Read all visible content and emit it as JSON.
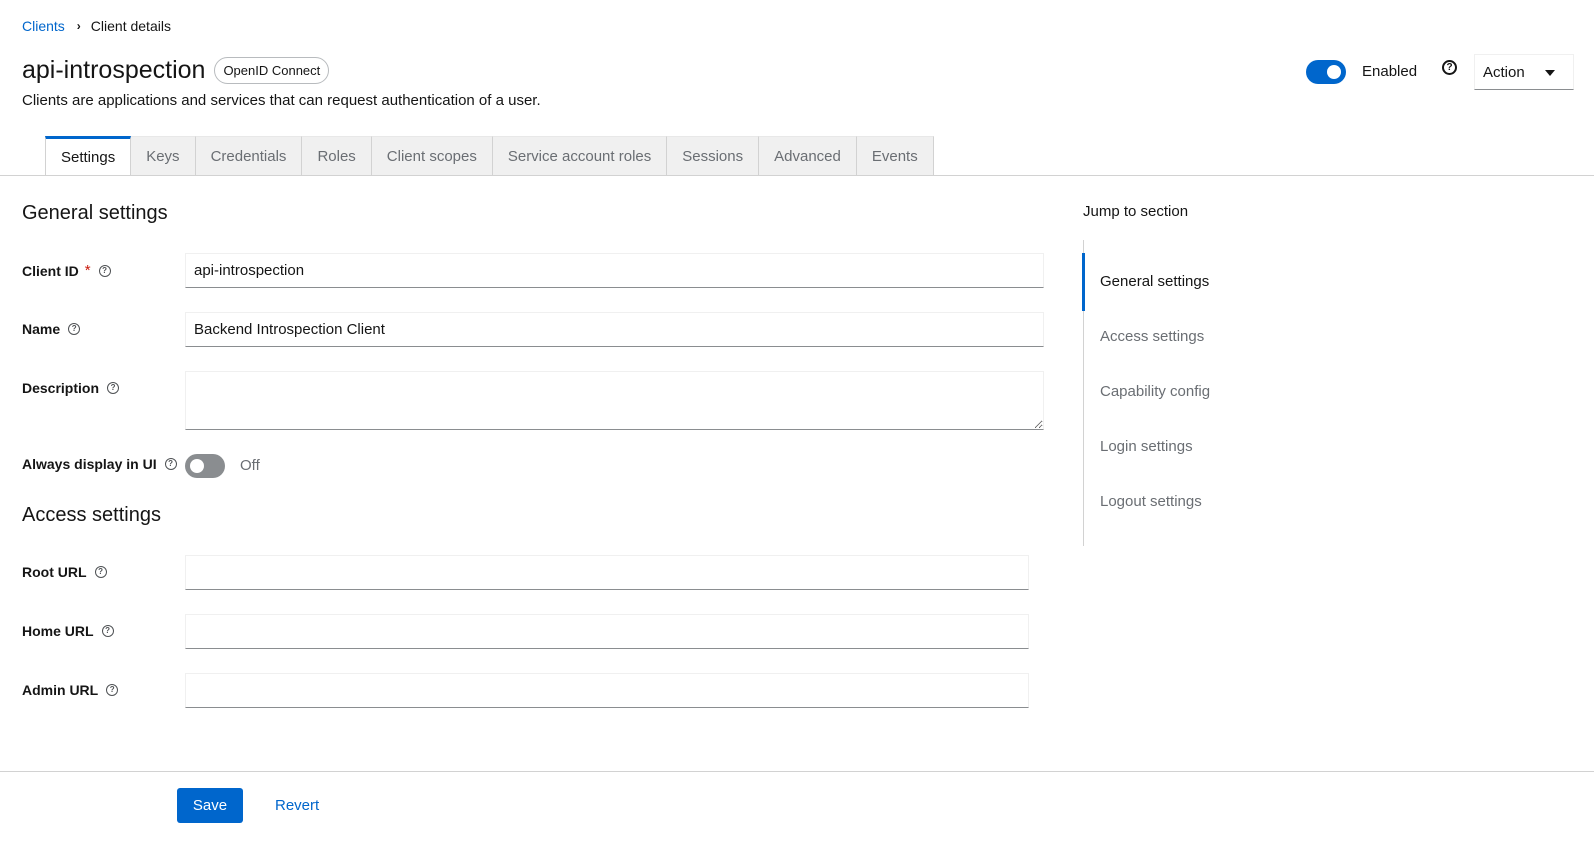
{
  "breadcrumb": {
    "parent": "Clients",
    "current": "Client details"
  },
  "header": {
    "title": "api-introspection",
    "badge": "OpenID Connect",
    "subtitle": "Clients are applications and services that can request authentication of a user.",
    "enabled_label": "Enabled",
    "enabled": true,
    "help_glyph": "?",
    "action_label": "Action"
  },
  "tabs": [
    {
      "label": "Settings",
      "active": true
    },
    {
      "label": "Keys"
    },
    {
      "label": "Credentials"
    },
    {
      "label": "Roles"
    },
    {
      "label": "Client scopes"
    },
    {
      "label": "Service account roles"
    },
    {
      "label": "Sessions"
    },
    {
      "label": "Advanced"
    },
    {
      "label": "Events"
    }
  ],
  "general": {
    "title": "General settings",
    "client_id_label": "Client ID",
    "required_marker": "*",
    "client_id_value": "api-introspection",
    "name_label": "Name",
    "name_value": "Backend Introspection Client",
    "description_label": "Description",
    "description_value": "",
    "always_display_label": "Always display in UI",
    "always_display_state": "Off",
    "always_display_on": false
  },
  "access": {
    "title": "Access settings",
    "root_url_label": "Root URL",
    "root_url_value": "",
    "home_url_label": "Home URL",
    "home_url_value": "",
    "admin_url_label": "Admin URL",
    "admin_url_value": ""
  },
  "jump": {
    "title": "Jump to section",
    "items": [
      "General settings",
      "Access settings",
      "Capability config",
      "Login settings",
      "Logout settings"
    ],
    "active_index": 0
  },
  "footer": {
    "save_label": "Save",
    "revert_label": "Revert"
  },
  "icons": {
    "help": "help-circle-icon",
    "breadcrumb_separator": "chevron-right-icon",
    "dropdown": "caret-down-icon"
  },
  "colors": {
    "accent": "#0066cc",
    "required": "#c9190b",
    "muted_text": "#6a6e73",
    "tab_background": "#f0f0f0"
  }
}
